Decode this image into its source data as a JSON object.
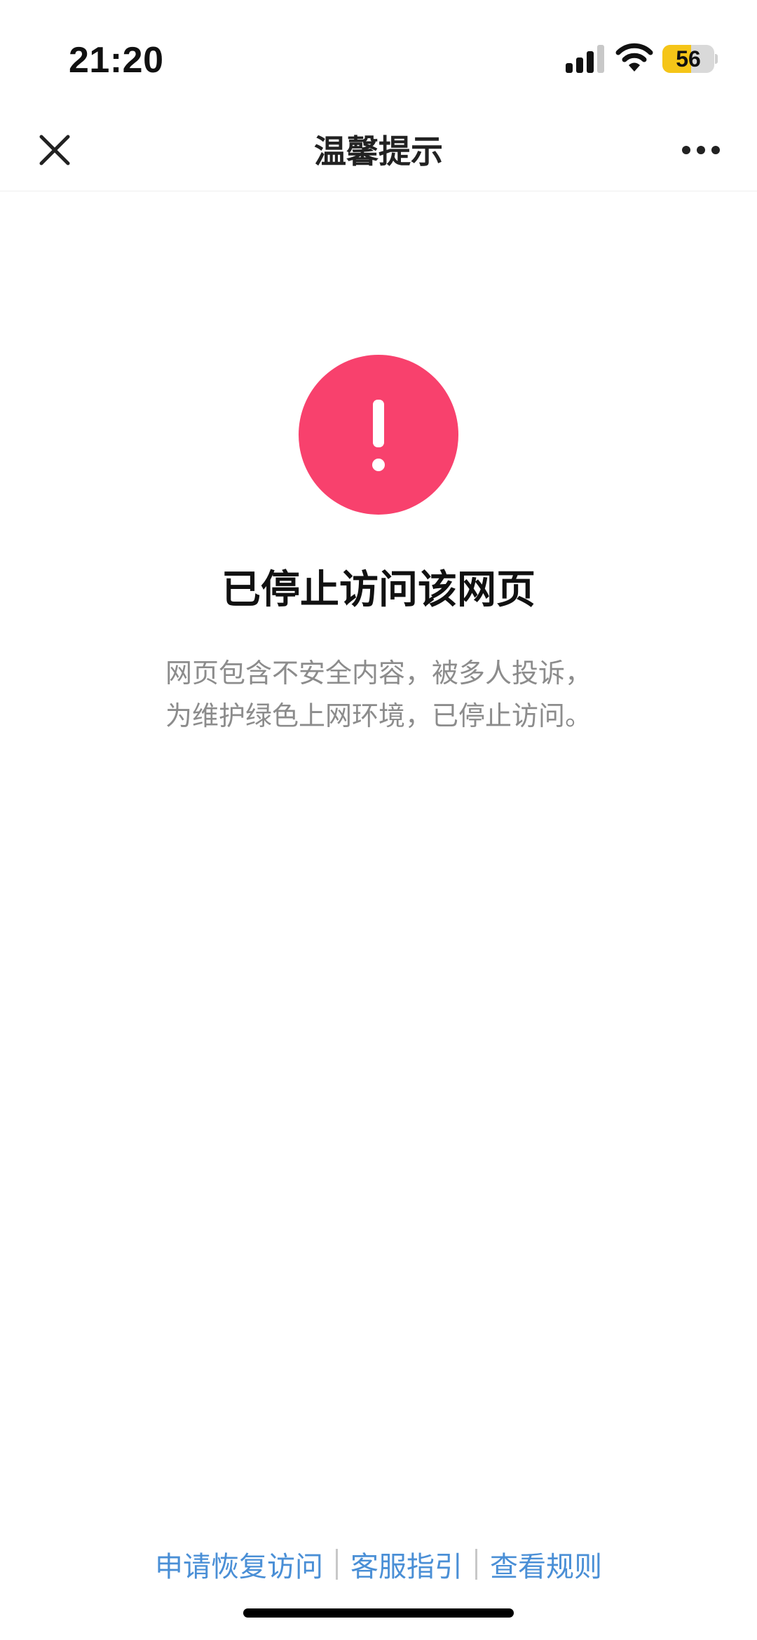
{
  "status_bar": {
    "time": "21:20",
    "battery_level": "56",
    "battery_fraction": 0.56,
    "signal_icon": "signal-bars-icon",
    "wifi_icon": "wifi-icon",
    "battery_color": "#f5c518"
  },
  "nav": {
    "title": "温馨提示",
    "close_icon": "close-icon",
    "more_icon": "more-icon"
  },
  "warning": {
    "icon": "exclamation-icon",
    "icon_color": "#f8416d",
    "headline": "已停止访问该网页",
    "description_lines": [
      "网页包含不安全内容，被多人投诉，",
      "为维护绿色上网环境，已停止访问。"
    ]
  },
  "footer": {
    "links": [
      "申请恢复访问",
      "客服指引",
      "查看规则"
    ],
    "link_color": "#4a8fd6"
  }
}
